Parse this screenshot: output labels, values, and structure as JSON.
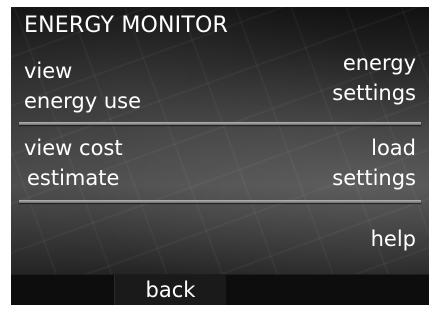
{
  "header": {
    "title": "ENERGY MONITOR"
  },
  "menu": {
    "left": [
      {
        "line1": "view",
        "line2": "energy use"
      },
      {
        "line1": "view cost",
        "line2": "estimate"
      }
    ],
    "right": [
      {
        "line1": "energy",
        "line2": "settings"
      },
      {
        "line1": "load",
        "line2": "settings"
      },
      {
        "line1": "help"
      }
    ]
  },
  "footer": {
    "back_label": "back"
  },
  "colors": {
    "screen_background": "#2f2f2f",
    "text": "#ffffff",
    "divider": "#a8a8a8",
    "footer_background": "#0b0b0b"
  }
}
